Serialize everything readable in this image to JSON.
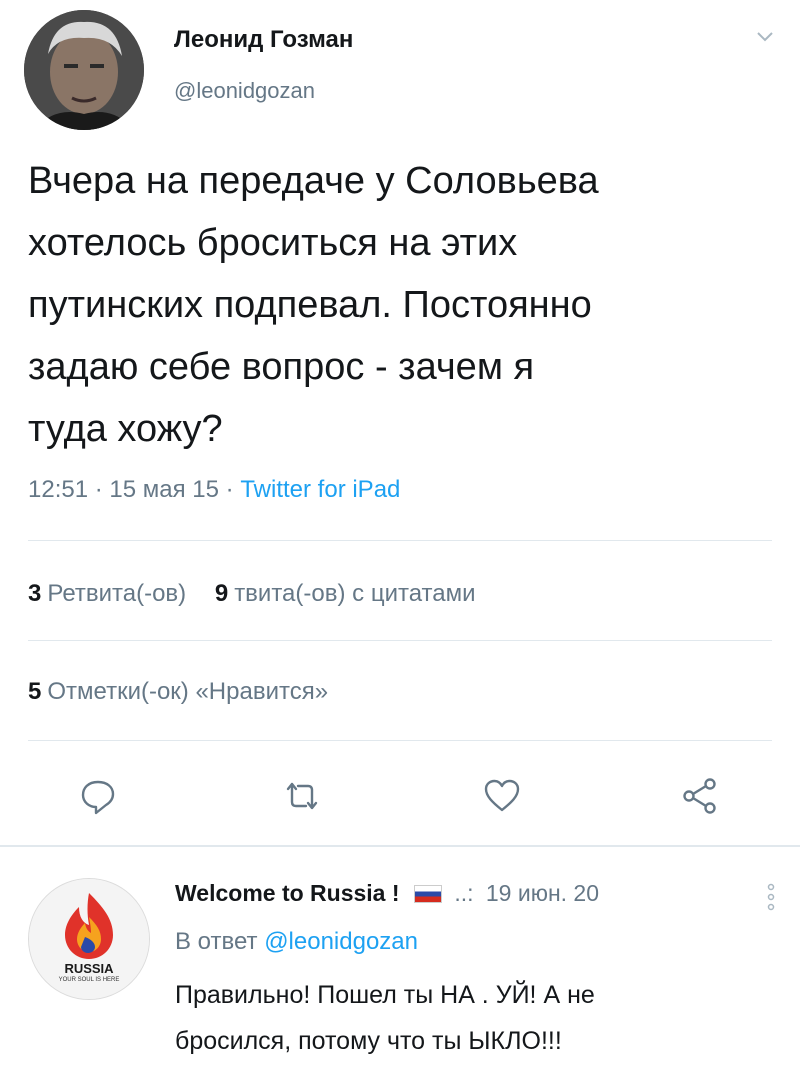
{
  "tweet": {
    "author_name": "Леонид Гозман",
    "author_handle": "@leonidgozan",
    "text_lines": [
      "Вчера на передаче у Соловьева",
      "хотелось броситься на этих",
      "путинских подпевал. Постоянно",
      "задаю себе вопрос - зачем я",
      "туда хожу?"
    ],
    "time": "12:51",
    "date": "15 мая 15",
    "separator": "·",
    "source": "Twitter for iPad"
  },
  "stats": {
    "retweets_count": "3",
    "retweets_label": "Ретвита(-ов)",
    "quotes_count": "9",
    "quotes_label": "твита(-ов) с цитатами",
    "likes_count": "5",
    "likes_label": "Отметки(-ок) «Нравится»"
  },
  "icons": {
    "reply": "reply-icon",
    "retweet": "retweet-icon",
    "like": "heart-icon",
    "share": "share-icon",
    "more": "chevron-down-icon"
  },
  "reply": {
    "author_name": "Welcome to Russia !",
    "date_prefix": "..:",
    "date": "19 июн. 20",
    "reply_to_label": "В ответ",
    "reply_to_handle": "@leonidgozan",
    "text_lines": [
      "Правильно! Пошел ты НА . УЙ!  А не",
      "бросился, потому что ты    ЫКЛО!!!"
    ],
    "avatar_logo_text": "RUSSIA",
    "avatar_logo_subtext": "YOUR SOUL IS HERE"
  },
  "colors": {
    "accent": "#1da1f2",
    "muted": "#657786",
    "text": "#14171a",
    "divider": "#e1e8ed"
  }
}
